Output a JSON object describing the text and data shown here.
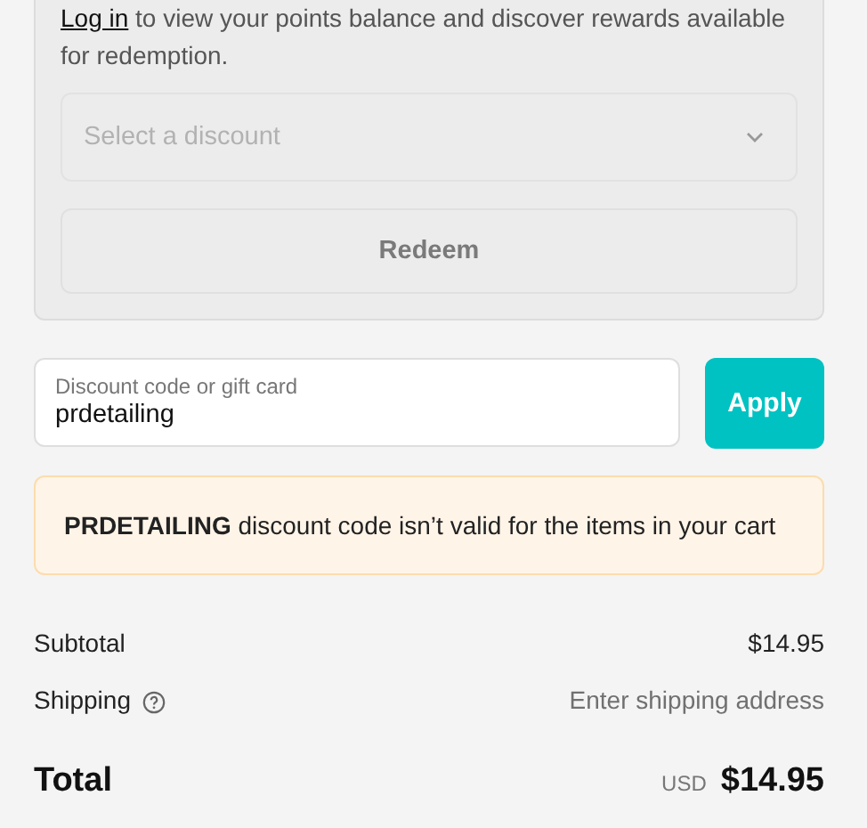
{
  "rewards": {
    "login_link": "Log in",
    "prompt": "to view your points balance and discover rewards available for redemption.",
    "discount_select": {
      "placeholder": "Select a discount",
      "disabled": true
    },
    "redeem_button": {
      "label": "Redeem",
      "disabled": true
    }
  },
  "discount_field": {
    "label": "Discount code or gift card",
    "value": "prdetailing"
  },
  "apply_button": "Apply",
  "alert": "**PRDETAILING** discount code isn’t valid for the items in your cart",
  "summary": [
    {
      "label": "Subtotal",
      "value": "$14.95",
      "kind": "amount"
    },
    {
      "label": "Shipping",
      "value": "Enter shipping address",
      "kind": "hint"
    }
  ],
  "total": {
    "label": "Total",
    "currency": "USD",
    "value": "$14.95"
  }
}
